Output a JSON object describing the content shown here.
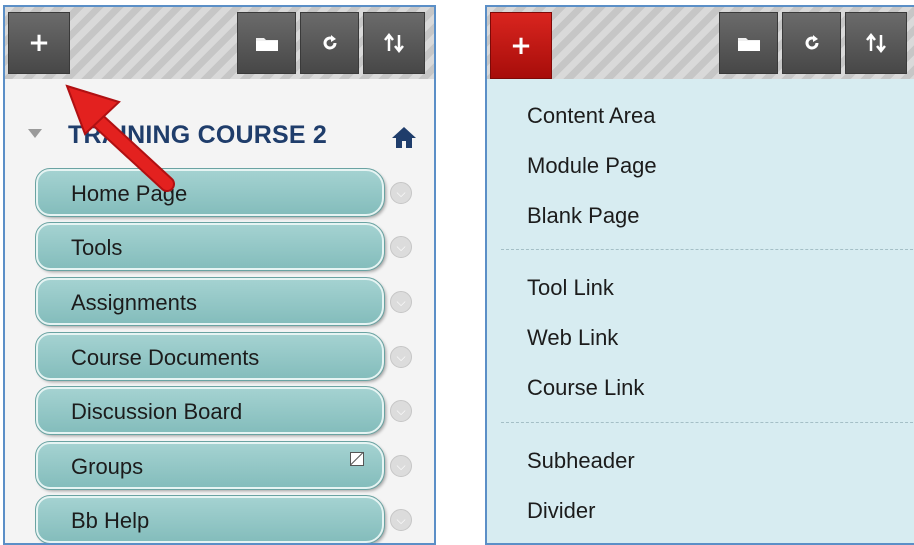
{
  "left": {
    "toolbar": {
      "add_label": "+",
      "icons": [
        "folder-icon",
        "refresh-icon",
        "sort-icon"
      ]
    },
    "course_title": "TRAINING COURSE 2",
    "nav_items": [
      {
        "label": "Home Page",
        "hidden": false
      },
      {
        "label": "Tools",
        "hidden": false
      },
      {
        "label": "Assignments",
        "hidden": false
      },
      {
        "label": "Course Documents",
        "hidden": false
      },
      {
        "label": "Discussion Board",
        "hidden": false
      },
      {
        "label": "Groups",
        "hidden": true
      },
      {
        "label": "Bb Help",
        "hidden": false
      }
    ]
  },
  "right": {
    "toolbar": {
      "add_label": "+",
      "icons": [
        "folder-icon",
        "refresh-icon",
        "sort-icon"
      ]
    },
    "menu_items": [
      "Content Area",
      "Module Page",
      "Blank Page",
      "Tool Link",
      "Web Link",
      "Course Link",
      "Subheader",
      "Divider"
    ]
  },
  "colors": {
    "accent_red": "#c8161d",
    "nav_teal": "#94c8c7",
    "menu_bg": "#d7ecf1",
    "title_navy": "#1f3d6b",
    "panel_border": "#5b8fc7"
  }
}
